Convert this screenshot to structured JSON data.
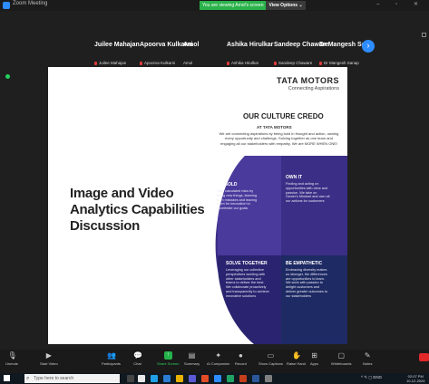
{
  "window": {
    "title": "Zoom Meeting",
    "share_banner_viewing": "You are viewing Amol's screen",
    "share_banner_options": "View Options  ⌄",
    "controls": "–  ▫  ✕"
  },
  "participants": [
    {
      "name": "Juilee Mahajan",
      "tag": "Juilee Mahajan",
      "muted": true
    },
    {
      "name": "Apoorva Kulkarni",
      "tag": "Apoorva Kulkarni",
      "muted": true
    },
    {
      "name": "Amol",
      "tag": "Amol",
      "muted": false
    },
    {
      "name": "Ashika Hirulkar",
      "tag": "Ashika Hirulkar",
      "muted": true
    },
    {
      "name": "Sandeep Chaware",
      "tag": "Sandeep Chaware",
      "muted": true
    },
    {
      "name": "Dr Mangesh Sa...",
      "tag": "Dr Mangesh Sanap",
      "muted": true
    }
  ],
  "slide": {
    "logo": "TATA MOTORS",
    "logo_tagline": "Connecting Aspirations",
    "credo_title": "OUR CULTURE CREDO",
    "credo_subtitle": "AT TATA MOTORS",
    "credo_body": "We are connecting aspirations by being bold in thought and action, owning every opportunity and challenge, Solving together as one team and engaging all our stakeholders with empathy. We are MORE WHEN ONE!",
    "heading": "Image and Video Analytics Capabilities Discussion",
    "values": [
      {
        "title": "BE BOLD",
        "body": "Take calculated risks by trying new things, learning from mistakes and leaving room for innovation to accelerate our goals"
      },
      {
        "title": "OWN IT",
        "body": "Finding and acting on opportunities with drive and passion. We take on Owner's Mindset and own all our actions for customers"
      },
      {
        "title": "SOLVE TOGETHER",
        "body": "Leveraging our collective perspectives working with other stakeholders and teams to deliver the best. We collaborate proactively and transparently to achieve innovative solutions"
      },
      {
        "title": "BE EMPATHETIC",
        "body": "Embracing diversity makes us stronger, the differences are opportunities to learn. We work with passion to delight customers and deliver greater outcomes to our stakeholders"
      }
    ]
  },
  "toolbar": {
    "items": [
      {
        "label": "Unmute",
        "icon": "mic-icon"
      },
      {
        "label": "Start Video",
        "icon": "video-icon"
      },
      {
        "label": "Participants",
        "icon": "participants-icon",
        "count": "11"
      },
      {
        "label": "Chat",
        "icon": "chat-icon"
      },
      {
        "label": "Share Screen",
        "icon": "share-screen-icon"
      },
      {
        "label": "Summary",
        "icon": "summary-icon"
      },
      {
        "label": "AI Companion",
        "icon": "ai-companion-icon"
      },
      {
        "label": "Record",
        "icon": "record-icon"
      },
      {
        "label": "Show Captions",
        "icon": "captions-icon"
      },
      {
        "label": "Raise Hand",
        "icon": "raise-hand-icon"
      },
      {
        "label": "Apps",
        "icon": "apps-icon"
      },
      {
        "label": "Whiteboards",
        "icon": "whiteboards-icon"
      },
      {
        "label": "Notes",
        "icon": "notes-icon"
      }
    ],
    "participants_count": "11",
    "end_color": "#e02828"
  },
  "taskbar": {
    "search_placeholder": "Type here to search",
    "tray_text": "^ ✎ ◻ ENG",
    "time": "02:07 PM",
    "date": "10-12-2024"
  },
  "colors": {
    "accent": "#2d8cff",
    "share_green": "#23b34a",
    "slide_purple": "#3b2e86",
    "slide_navy": "#1e2a63"
  }
}
